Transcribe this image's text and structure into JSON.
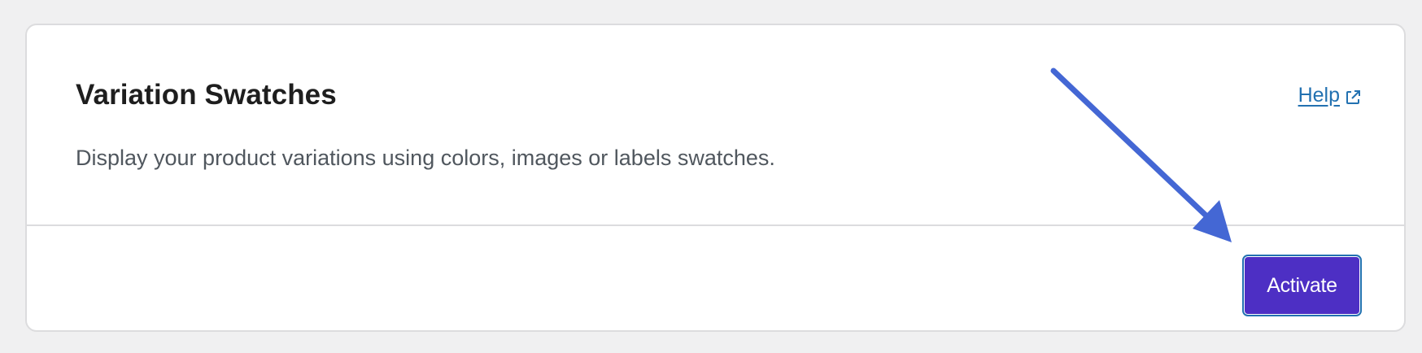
{
  "colors": {
    "page_background": "#f0f0f1",
    "card_background": "#ffffff",
    "title": "#1e1e1e",
    "description": "#50575e",
    "link": "#2271b1",
    "button_background": "#4d2fc4",
    "button_text": "#ffffff",
    "arrow": "#4467d4"
  },
  "module": {
    "title": "Variation Swatches",
    "description": "Display your product variations using colors, images or labels swatches.",
    "help_label": "Help",
    "help_icon": "external-link-icon",
    "activate_label": "Activate"
  },
  "annotation": {
    "icon": "arrow-pointing-to-activate-button"
  }
}
